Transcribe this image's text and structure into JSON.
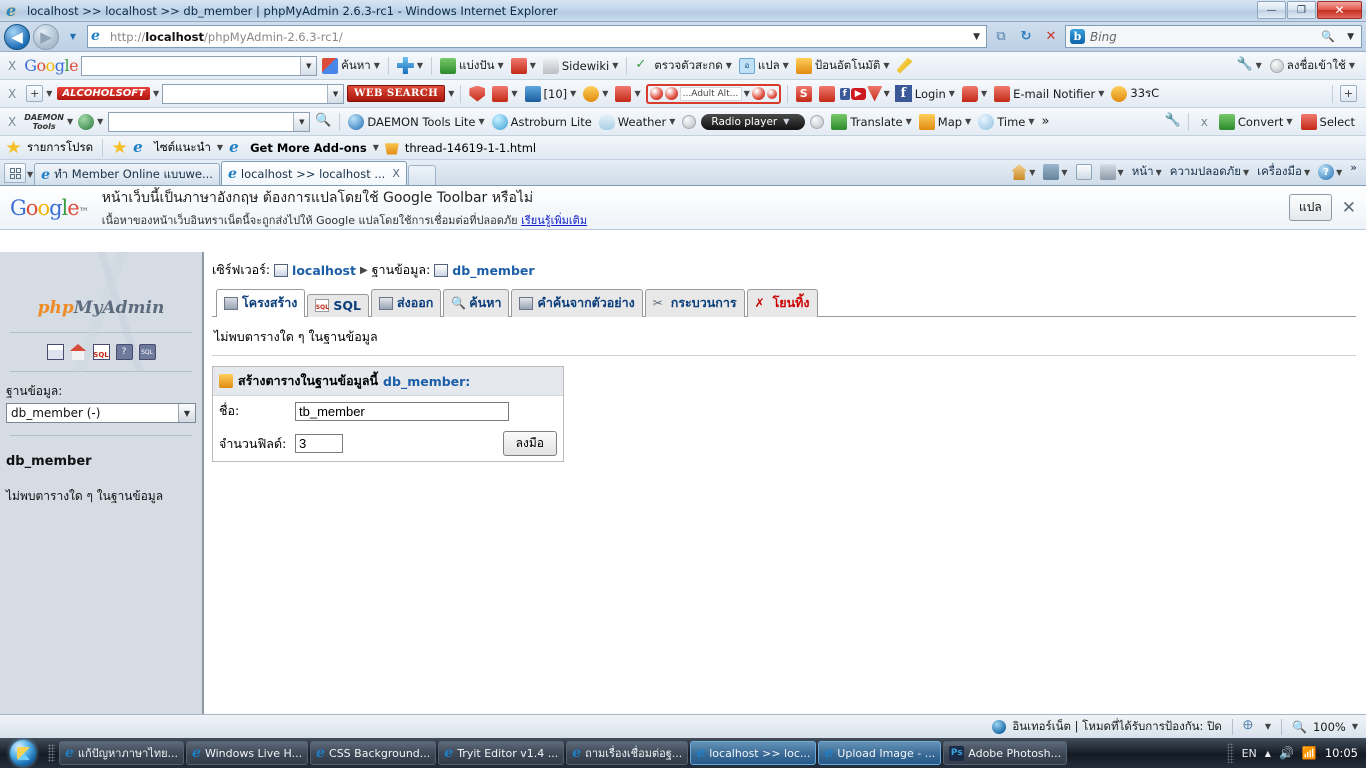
{
  "window": {
    "title": "localhost >> localhost >> db_member | phpMyAdmin 2.6.3-rc1 - Windows Internet Explorer",
    "minimize_label": "—",
    "maximize_label": "❐",
    "close_label": "✕"
  },
  "address_bar": {
    "url_prefix": "http://",
    "url_host": "localhost",
    "url_path": "/phpMyAdmin-2.6.3-rc1/",
    "search_placeholder": "Bing",
    "back_label": "◀",
    "forward_label": "▶",
    "dropdown_label": "▼",
    "compat_label": "⧉",
    "refresh_label": "↻",
    "stop_label": "✕",
    "search_icon": "🔍"
  },
  "google_toolbar": {
    "close_label": "X",
    "logo": "Google",
    "search_value": "",
    "items": [
      {
        "label": "ค้นหา",
        "icon": "google-colors-icon",
        "caret": true
      },
      {
        "label": "",
        "icon": "plus-icon",
        "caret": true
      },
      {
        "label": "แบ่งปัน",
        "icon": "share-icon",
        "caret": true
      },
      {
        "label": "",
        "icon": "bookmark-icon",
        "caret": true
      },
      {
        "label": "Sidewiki",
        "icon": "sidewiki-icon",
        "caret": true
      },
      {
        "label": "ตรวจตัวสะกด",
        "icon": "spellcheck-icon",
        "caret": true
      },
      {
        "label": "แปล",
        "icon": "translate-icon",
        "caret": true
      },
      {
        "label": "ป้อนอัตโนมัติ",
        "icon": "autofill-icon",
        "caret": true
      },
      {
        "label": "",
        "icon": "highlighter-icon",
        "caret": false
      }
    ],
    "right_items": [
      {
        "label": "",
        "icon": "wrench-icon",
        "caret": true
      },
      {
        "label": "ลงชื่อเข้าใช้",
        "icon": "avatar-icon",
        "caret": true
      }
    ]
  },
  "alcohol_toolbar": {
    "close_label": "X",
    "brand": "ALCOHOLSOFT",
    "search_value": "",
    "web_search_label": "WEB SEARCH",
    "counter_label": "[10]",
    "adult_field_label": "...Adult Alt...",
    "facebook_label": "Login",
    "email_label": "E-mail Notifier",
    "temp_label": "33รC",
    "add_label": "+"
  },
  "daemon_toolbar": {
    "close_label": "X",
    "brand_line1": "DAEMON",
    "brand_line2": "Tools",
    "search_value": "",
    "items": [
      {
        "label": "DAEMON Tools Lite",
        "icon": "daemon-icon",
        "caret": true
      },
      {
        "label": "Astroburn Lite",
        "icon": "astroburn-icon",
        "caret": false
      },
      {
        "label": "Weather",
        "icon": "weather-icon",
        "caret": true
      },
      {
        "label": "Radio player",
        "icon": "radio-icon",
        "caret": true
      },
      {
        "label": "Translate",
        "icon": "translate2-icon",
        "caret": true
      },
      {
        "label": "Map",
        "icon": "map-icon",
        "caret": true
      },
      {
        "label": "Time",
        "icon": "clock-icon",
        "caret": true
      },
      {
        "label": "»",
        "icon": "chevrons-icon",
        "caret": false
      }
    ],
    "convert_label": "Convert",
    "select_label": "Select",
    "close2_label": "x"
  },
  "favorites_bar": {
    "favorites_label": "รายการโปรด",
    "items": [
      {
        "label": "ไซต์แนะนำ",
        "icon": "ie-icon",
        "caret": true
      },
      {
        "label": "Get More Add-ons",
        "icon": "ie-icon",
        "caret": true
      },
      {
        "label": "thread-14619-1-1.html",
        "icon": "page-icon",
        "caret": false
      }
    ]
  },
  "tabs": {
    "quicktabs_label": "▦",
    "items": [
      {
        "label": "ทำ Member Online แบบwe...",
        "active": false,
        "closeable": false
      },
      {
        "label": "localhost >> localhost ...",
        "active": true,
        "closeable": true,
        "close_label": "X"
      }
    ],
    "new_tab_label": "",
    "right_items": [
      {
        "label": "",
        "icon": "home-icon",
        "caret": true
      },
      {
        "label": "",
        "icon": "rss-icon",
        "caret": true
      },
      {
        "label": "",
        "icon": "mail-icon",
        "caret": false
      },
      {
        "label": "",
        "icon": "print-icon",
        "caret": true
      },
      {
        "label": "หน้า",
        "icon": "",
        "caret": true
      },
      {
        "label": "ความปลอดภัย",
        "icon": "",
        "caret": true
      },
      {
        "label": "เครื่องมือ",
        "icon": "",
        "caret": true
      },
      {
        "label": "",
        "icon": "help-icon",
        "caret": true
      },
      {
        "label": "»",
        "icon": "",
        "caret": false
      }
    ]
  },
  "translate_bar": {
    "logo": "Google",
    "line1": "หน้าเว็บนี้เป็นภาษาอังกฤษ ต้องการแปลโดยใช้ Google Toolbar หรือไม่",
    "line2_pre": "เนื้อหาของหน้าเว็บอินทราเน็ตนี้จะถูกส่งไปให้ Google แปลโดยใช้การเชื่อมต่อที่ปลอดภัย",
    "line2_link": "เรียนรู้เพิ่มเติม",
    "translate_button": "แปล",
    "close_label": "✕"
  },
  "phpmyadmin": {
    "sidebar": {
      "logo_part1": "php",
      "logo_part2": "MyAdmin",
      "nav_icons": [
        "window-icon",
        "home-icon",
        "sql-icon",
        "help-balloon-icon",
        "sql-balloon-icon"
      ],
      "database_label": "ฐานข้อมูล:",
      "database_selected": "db_member (-)",
      "database_name": "db_member",
      "no_tables_text": "ไม่พบตารางใด ๆ ในฐานข้อมูล"
    },
    "breadcrumb": {
      "server_label": "เซิร์ฟเวอร์:",
      "server_value": "localhost",
      "separator": "▶",
      "db_label": "ฐานข้อมูล:",
      "db_value": "db_member"
    },
    "nav_tabs": [
      {
        "label": "โครงสร้าง",
        "icon": "structure-icon",
        "active": true,
        "danger": false
      },
      {
        "label": "SQL",
        "icon": "sql-icon",
        "active": false,
        "danger": false
      },
      {
        "label": "ส่งออก",
        "icon": "export-icon",
        "active": false,
        "danger": false
      },
      {
        "label": "ค้นหา",
        "icon": "search-icon",
        "active": false,
        "danger": false
      },
      {
        "label": "คำค้นจากตัวอย่าง",
        "icon": "query-icon",
        "active": false,
        "danger": false
      },
      {
        "label": "กระบวนการ",
        "icon": "operations-icon",
        "active": false,
        "danger": false
      },
      {
        "label": "โยนทิ้ง",
        "icon": "drop-icon",
        "active": false,
        "danger": true
      }
    ],
    "no_tables_text": "ไม่พบตารางใด ๆ ในฐานข้อมูล",
    "create_form": {
      "heading_prefix": "สร้างตารางในฐานข้อมูลนี้",
      "heading_db": "db_member:",
      "name_label": "ชื่อ:",
      "name_value": "tb_member",
      "fields_label": "จำนวนฟิลด์:",
      "fields_value": "3",
      "submit_label": "ลงมือ"
    }
  },
  "status_bar": {
    "zone_text": "อินเทอร์เน็ต | โหมดที่ได้รับการป้องกัน: ปิด",
    "zoom_value": "100%",
    "zoom_caret": "▼",
    "privacy_caret": "▼"
  },
  "taskbar": {
    "start_label": "",
    "buttons": [
      {
        "label": "แก้ปัญหาภาษาไทย...",
        "icon": "ie-icon",
        "active": false
      },
      {
        "label": "Windows Live H...",
        "icon": "ie-icon",
        "active": false
      },
      {
        "label": "CSS Background...",
        "icon": "ie-icon",
        "active": false
      },
      {
        "label": "Tryit Editor v1.4 ...",
        "icon": "ie-icon",
        "active": false
      },
      {
        "label": "ถามเรื่องเชื่อมต่อฐ...",
        "icon": "ie-icon",
        "active": false
      },
      {
        "label": "localhost >> loc...",
        "icon": "ie-icon",
        "active": true
      },
      {
        "label": "Upload Image - ...",
        "icon": "ie-icon",
        "active": true
      },
      {
        "label": "Adobe Photosh...",
        "icon": "ps-icon",
        "active": false
      }
    ],
    "tray": {
      "language": "EN",
      "show_hidden": "▲",
      "volume_icon": "speaker-icon",
      "network_icon": "signal-icon",
      "clock": "10:05"
    }
  },
  "colors": {
    "accent_blue": "#1c5ea8",
    "danger_red": "#cc0000",
    "pma_orange": "#f08a24",
    "taskbar_dark": "#121821"
  }
}
